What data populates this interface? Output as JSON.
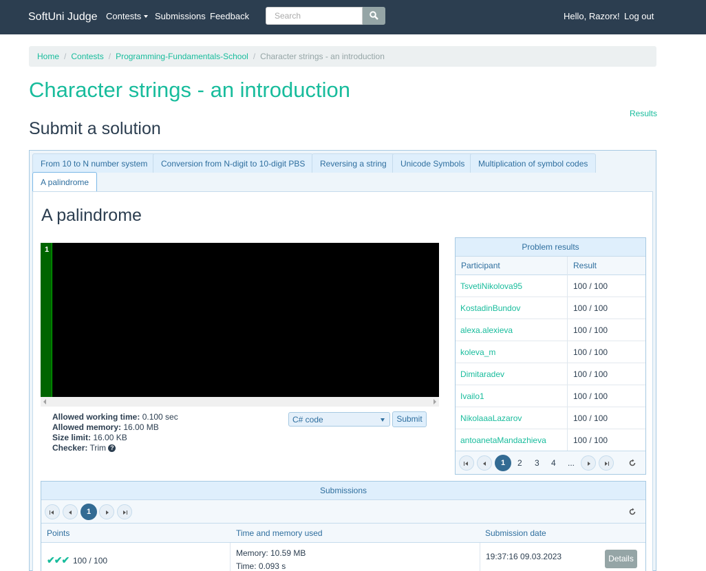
{
  "navbar": {
    "brand": "SoftUni Judge",
    "contests": "Contests",
    "submissions": "Submissions",
    "feedback": "Feedback",
    "search_placeholder": "Search",
    "greeting": "Hello, Razorx!",
    "logout": "Log out"
  },
  "breadcrumb": [
    "Home",
    "Contests",
    "Programming-Fundamentals-School",
    "Character strings - an introduction"
  ],
  "page_title": "Character strings - an introduction",
  "results_link": "Results",
  "submit_title": "Submit a solution",
  "tabs": [
    "From 10 to N number system",
    "Conversion from N-digit to 10-digit PBS",
    "Reversing a string",
    "Unicode Symbols",
    "Multiplication of symbol codes",
    "A palindrome"
  ],
  "problem": {
    "title": "A palindrome",
    "line_number": "1",
    "limits": {
      "time_label": "Allowed working time:",
      "time_value": "0.100 sec",
      "memory_label": "Allowed memory:",
      "memory_value": "16.00 MB",
      "size_label": "Size limit:",
      "size_value": "16.00 KB",
      "checker_label": "Checker:",
      "checker_value": "Trim",
      "help_glyph": "?"
    },
    "language": "C# code",
    "submit_label": "Submit"
  },
  "problem_results": {
    "caption": "Problem results",
    "col_participant": "Participant",
    "col_result": "Result",
    "rows": [
      {
        "participant": "TsvetiNikolova95",
        "result": "100 / 100"
      },
      {
        "participant": "KostadinBundov",
        "result": "100 / 100"
      },
      {
        "participant": "alexa.alexieva",
        "result": "100 / 100"
      },
      {
        "participant": "koleva_m",
        "result": "100 / 100"
      },
      {
        "participant": "Dimitaradev",
        "result": "100 / 100"
      },
      {
        "participant": "Ivailo1",
        "result": "100 / 100"
      },
      {
        "participant": "NikolaaaLazarov",
        "result": "100 / 100"
      },
      {
        "participant": "antoanetaMandazhieva",
        "result": "100 / 100"
      }
    ],
    "pager": {
      "current": "1",
      "pages": [
        "2",
        "3",
        "4"
      ],
      "ellipsis": "..."
    }
  },
  "submissions": {
    "caption": "Submissions",
    "pager_current": "1",
    "col_points": "Points",
    "col_time_memory": "Time and memory used",
    "col_date": "Submission date",
    "rows": [
      {
        "checks": "✔✔✔",
        "points": "100 / 100",
        "memory": "Memory: 10.59 MB",
        "time": "Time: 0.093 s",
        "date": "19:37:16 09.03.2023",
        "details": "Details"
      }
    ]
  },
  "colors": {
    "navbar": "#2c3e50",
    "accent": "#18bc9c",
    "editor_bg": "#000000",
    "gutter": "#006400",
    "pager_current": "#336b93"
  },
  "icons": [
    "search-icon",
    "caret-down-icon",
    "help-icon",
    "refresh-icon",
    "check-icon",
    "first-page-icon",
    "prev-page-icon",
    "next-page-icon",
    "last-page-icon"
  ]
}
